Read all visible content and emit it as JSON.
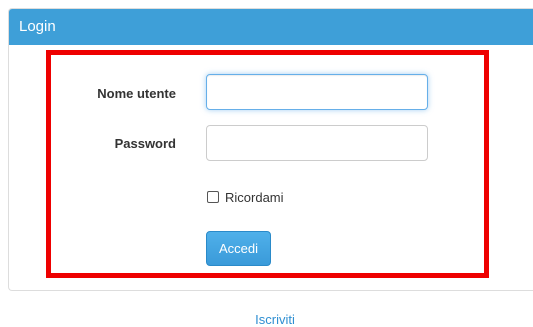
{
  "panel": {
    "title": "Login"
  },
  "form": {
    "username_label": "Nome utente",
    "username_value": "",
    "password_label": "Password",
    "password_value": "",
    "remember_label": "Ricordami",
    "remember_checked": false,
    "submit_label": "Accedi"
  },
  "footer": {
    "signup_link": "Iscriviti"
  },
  "colors": {
    "header": "#3e9fd8",
    "button": "#3a9ad9",
    "link": "#2f8fd2",
    "highlight_box": "#ee0000"
  }
}
